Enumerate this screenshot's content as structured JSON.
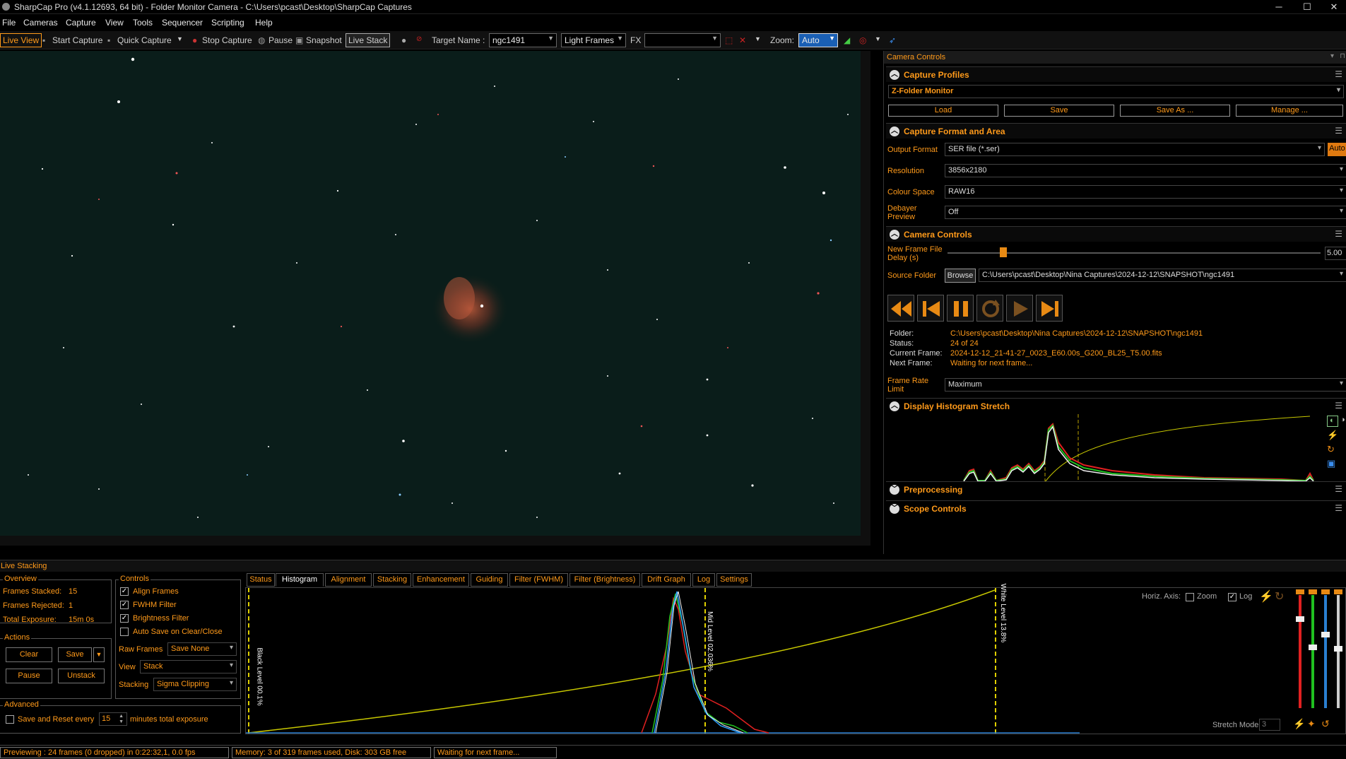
{
  "window": {
    "title": "SharpCap Pro (v4.1.12693, 64 bit) - Folder Monitor Camera - C:\\Users\\pcast\\Desktop\\SharpCap Captures",
    "minimize": "─",
    "maximize": "☐",
    "close": "✕"
  },
  "menu": [
    "File",
    "Cameras",
    "Capture",
    "View",
    "Tools",
    "Sequencer",
    "Scripting",
    "Help"
  ],
  "toolbar": {
    "live_view": "Live View",
    "start_capture": "Start Capture",
    "quick_capture": "Quick Capture",
    "stop_capture": "Stop Capture",
    "pause": "Pause",
    "snapshot": "Snapshot",
    "live_stack": "Live Stack",
    "target_name_label": "Target Name :",
    "target_name": "ngc1491",
    "frame_type": "Light Frames",
    "fx_label": "FX",
    "fx_value": "",
    "zoom_label": "Zoom:",
    "zoom_value": "Auto"
  },
  "camera_controls": {
    "title": "Camera Controls",
    "capture_profiles": {
      "title": "Capture Profiles",
      "profile": "Z-Folder Monitor",
      "buttons": [
        "Load",
        "Save",
        "Save As ...",
        "Manage ..."
      ]
    },
    "format": {
      "title": "Capture Format and Area",
      "output_label": "Output Format",
      "output": "SER file (*.ser)",
      "auto": "Auto",
      "resolution_label": "Resolution",
      "resolution": "3856x2180",
      "colour_label": "Colour Space",
      "colour": "RAW16",
      "debayer_label1": "Debayer",
      "debayer_label2": "Preview",
      "debayer": "Off"
    },
    "controls": {
      "title": "Camera Controls",
      "delay_label1": "New Frame File",
      "delay_label2": "Delay (s)",
      "delay_value": "5.00",
      "delay_fraction": 0.14,
      "source_label": "Source Folder",
      "browse": "Browse",
      "source_path": "C:\\Users\\pcast\\Desktop\\Nina Captures\\2024-12-12\\SNAPSHOT\\ngc1491",
      "info": [
        {
          "k": "Folder:",
          "v": "C:\\Users\\pcast\\Desktop\\Nina Captures\\2024-12-12\\SNAPSHOT\\ngc1491"
        },
        {
          "k": "Status:",
          "v": "24 of 24"
        },
        {
          "k": "Current Frame:",
          "v": "2024-12-12_21-41-27_0023_E60.00s_G200_BL25_T5.00.fits"
        },
        {
          "k": "Next Frame:",
          "v": "Waiting for next frame..."
        }
      ],
      "rate_label1": "Frame Rate",
      "rate_label2": "Limit",
      "rate": "Maximum"
    },
    "histogram": {
      "title": "Display Histogram Stretch"
    },
    "preprocessing": {
      "title": "Preprocessing"
    },
    "scope": {
      "title": "Scope Controls"
    }
  },
  "live_stacking": {
    "title": "Live Stacking",
    "overview": {
      "title": "Overview",
      "stacked_label": "Frames Stacked:",
      "stacked": "15",
      "rejected_label": "Frames Rejected:",
      "rejected": "1",
      "exposure_label": "Total Exposure:",
      "exposure": "15m 0s"
    },
    "controls": {
      "title": "Controls",
      "align": "Align Frames",
      "fwhm": "FWHM Filter",
      "brightness": "Brightness Filter",
      "autosave": "Auto Save on Clear/Close",
      "raw_label": "Raw Frames",
      "raw": "Save None",
      "view_label": "View",
      "view": "Stack",
      "stacking_label": "Stacking",
      "stacking": "Sigma Clipping"
    },
    "actions": {
      "title": "Actions",
      "clear": "Clear",
      "save": "Save",
      "pause": "Pause",
      "unstack": "Unstack"
    },
    "advanced": {
      "title": "Advanced",
      "save_reset": "Save and Reset every",
      "minutes": "15",
      "suffix": "minutes total exposure"
    },
    "tabs": [
      "Status",
      "Histogram",
      "Alignment",
      "Stacking",
      "Enhancement",
      "Guiding",
      "Filter (FWHM)",
      "Filter (Brightness)",
      "Drift Graph",
      "Log",
      "Settings"
    ],
    "active_tab": "Histogram",
    "hist": {
      "horiz_axis": "Horiz. Axis:",
      "zoom": "Zoom",
      "log": "Log",
      "black_level": "Black Level  00.1%",
      "mid_level": "Mid Level  02.036%",
      "white_level": "White Level  13.8%",
      "stretch_mode": "Stretch Mode",
      "stretch_value": "3"
    }
  },
  "status": {
    "preview": "Previewing : 24 frames (0 dropped) in 0:22:32,1, 0.0 fps",
    "memory": "Memory: 3 of 319 frames used, Disk: 303 GB free",
    "waiting": "Waiting for next frame..."
  },
  "colors": {
    "accent": "#ff9a1a",
    "panel_bg": "#000000",
    "sky": "#0a1d1a"
  }
}
